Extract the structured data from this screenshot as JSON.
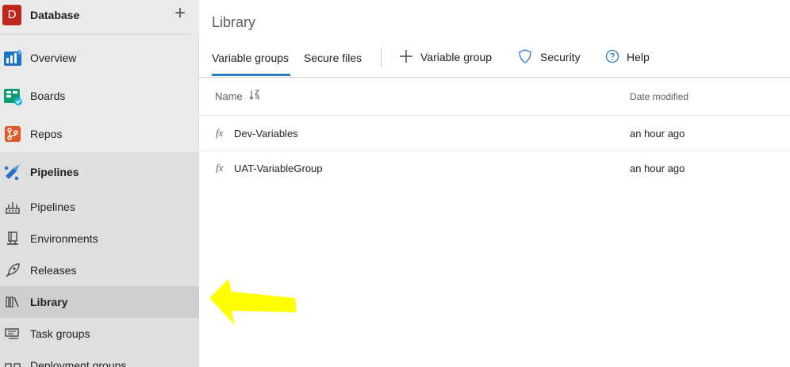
{
  "project": {
    "badge_letter": "D",
    "name": "Database",
    "add_symbol": "+"
  },
  "nav": {
    "overview": "Overview",
    "boards": "Boards",
    "repos": "Repos",
    "pipelines_section": "Pipelines",
    "pipelines": "Pipelines",
    "environments": "Environments",
    "releases": "Releases",
    "library": "Library",
    "task_groups": "Task groups",
    "deployment_groups": "Deployment groups"
  },
  "page": {
    "title": "Library",
    "tabs": [
      "Variable groups",
      "Secure files"
    ],
    "active_tab": "Variable groups",
    "tools": {
      "add_variable_group": "Variable group",
      "security": "Security",
      "help": "Help"
    }
  },
  "table": {
    "columns": {
      "name": "Name",
      "date_modified": "Date modified"
    },
    "rows": [
      {
        "icon": "fx",
        "name": "Dev-Variables",
        "modified": "an hour ago"
      },
      {
        "icon": "fx",
        "name": "UAT-VariableGroup",
        "modified": "an hour ago"
      }
    ]
  },
  "colors": {
    "project_badge": "#c0261c",
    "accent": "#2b7ac4",
    "annotation_arrow": "#ffff00",
    "sidebar_bg": "#eaeaea",
    "selected_bg": "#cfcfcf"
  }
}
